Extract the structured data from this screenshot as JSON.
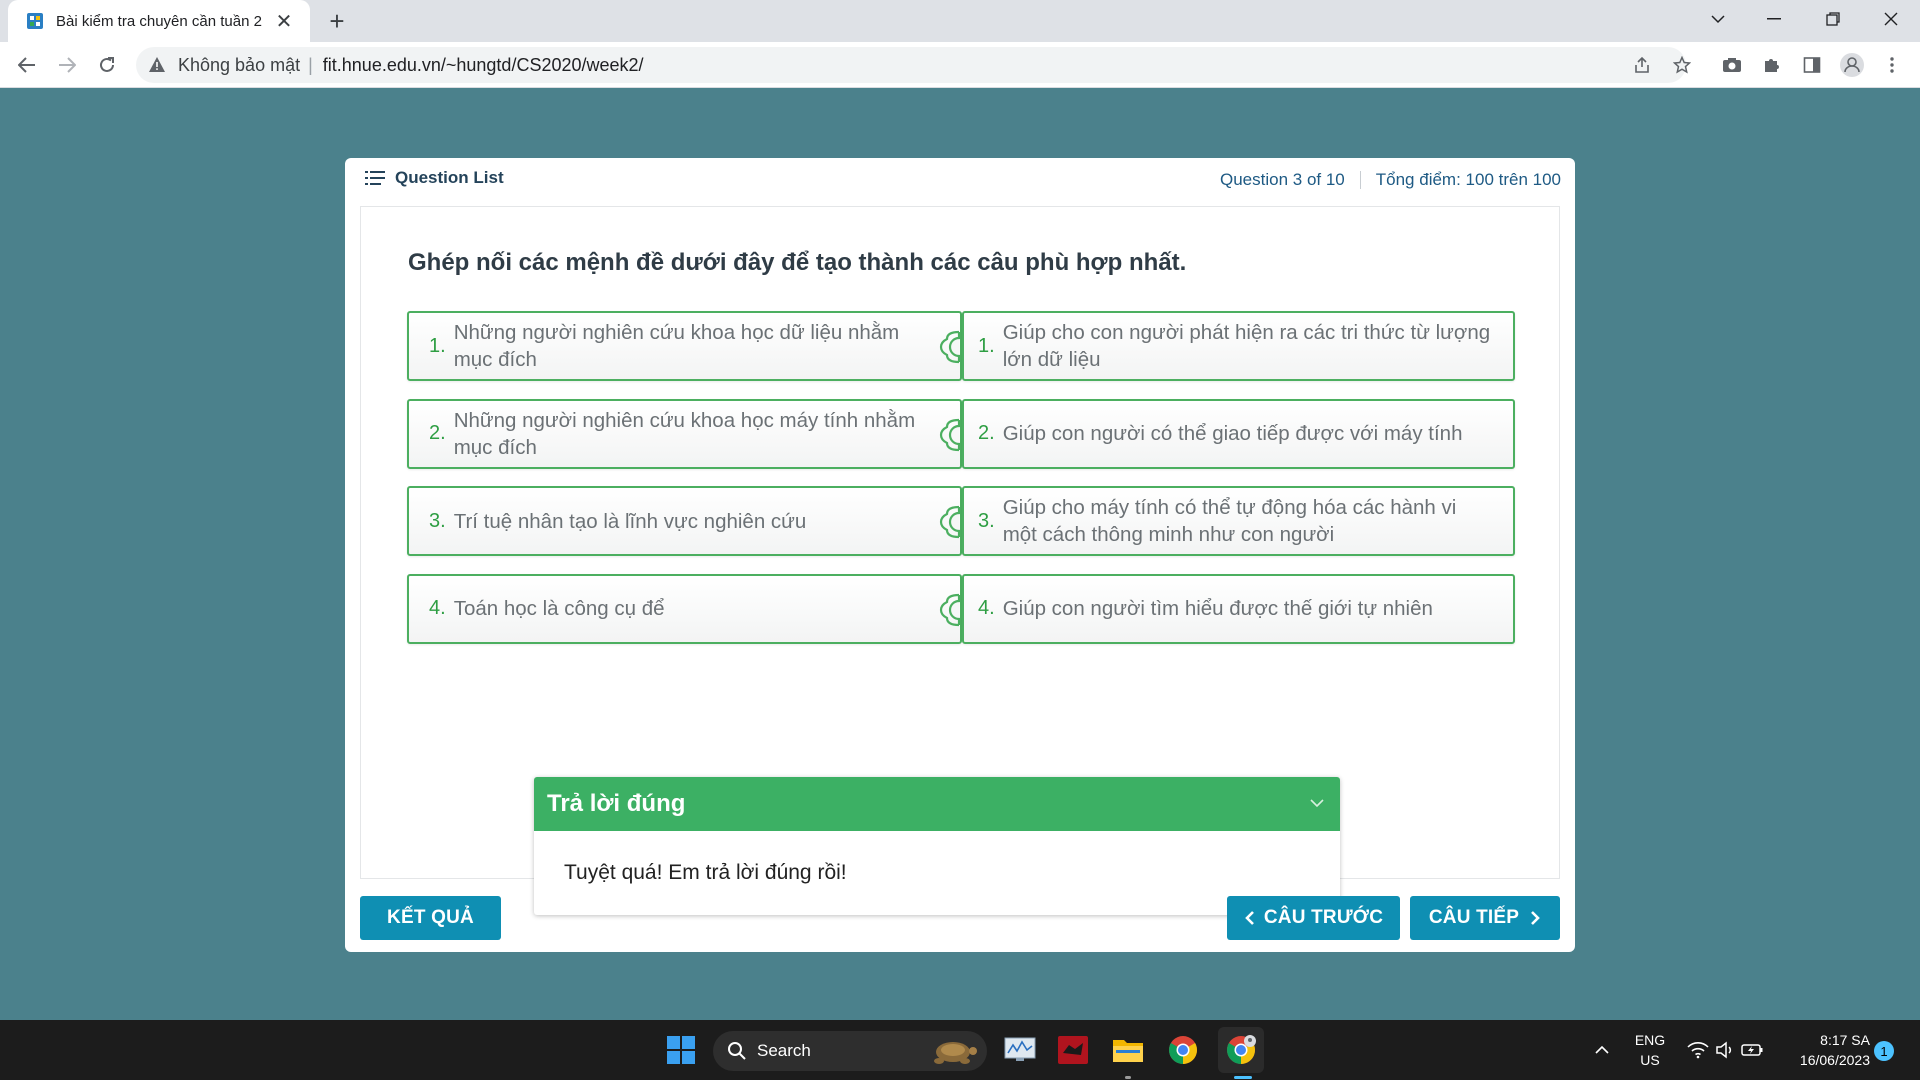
{
  "browser": {
    "tab_title": "Bài kiểm tra chuyên cần tuần 2",
    "security_label": "Không bảo mật",
    "url": "fit.hnue.edu.vn/~hungtd/CS2020/week2/"
  },
  "quiz": {
    "question_list_label": "Question List",
    "progress": "Question 3 of 10",
    "score": "Tổng điểm: 100 trên 100",
    "question_text": "Ghép nối các mệnh đề dưới đây để tạo thành các câu phù hợp nhất.",
    "pairs": [
      {
        "left_num": "1.",
        "left": "Những người nghiên cứu khoa học dữ liệu nhằm mục đích",
        "right_num": "1.",
        "right": "Giúp cho con người phát hiện ra các tri thức từ lượng lớn dữ liệu"
      },
      {
        "left_num": "2.",
        "left": "Những người nghiên cứu khoa học máy tính nhằm mục đích",
        "right_num": "2.",
        "right": "Giúp con người có thể giao tiếp được với máy tính"
      },
      {
        "left_num": "3.",
        "left": "Trí tuệ nhân tạo là lĩnh vực nghiên cứu",
        "right_num": "3.",
        "right": "Giúp cho máy tính có thể tự động hóa các hành vi một cách thông minh như con người"
      },
      {
        "left_num": "4.",
        "left": "Toán học là công cụ để",
        "right_num": "4.",
        "right": "Giúp con người tìm hiểu được thế giới tự nhiên"
      }
    ],
    "feedback_title": "Trả lời đúng",
    "feedback_message": "Tuyệt quá! Em trả lời đúng rồi!",
    "result_button": "KẾT QUẢ",
    "prev_button": "CÂU TRƯỚC",
    "next_button": "CÂU TIẾP"
  },
  "taskbar": {
    "search_label": "Search",
    "lang_primary": "ENG",
    "lang_secondary": "US",
    "time": "8:17 SA",
    "date": "16/06/2023",
    "notification_count": "1"
  },
  "colors": {
    "page_bg": "#4b818c",
    "match_border": "#4caf60",
    "feedback_header": "#3cb064",
    "button_bg": "#0f8fb3"
  }
}
